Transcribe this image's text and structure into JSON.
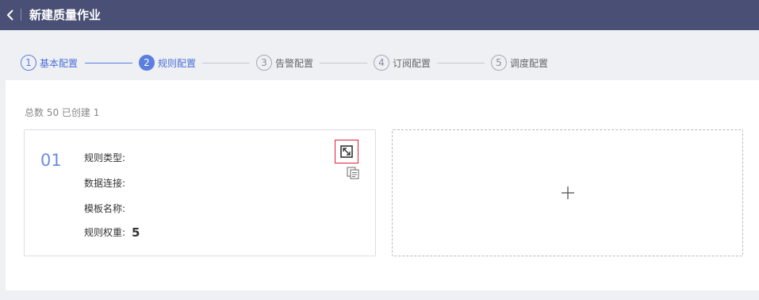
{
  "header": {
    "title": "新建质量作业",
    "back_icon": "chevron-left-icon"
  },
  "steps": [
    {
      "number": "1",
      "label": "基本配置",
      "state": "done"
    },
    {
      "number": "2",
      "label": "规则配置",
      "state": "active"
    },
    {
      "number": "3",
      "label": "告警配置",
      "state": "pending"
    },
    {
      "number": "4",
      "label": "订阅配置",
      "state": "pending"
    },
    {
      "number": "5",
      "label": "调度配置",
      "state": "pending"
    }
  ],
  "summary": "总数 50 已创建 1",
  "rule_card": {
    "index": "01",
    "rule_type_label": "规则类型:",
    "data_connection_label": "数据连接:",
    "template_name_label": "模板名称:",
    "weight_label": "规则权重:",
    "weight_value": "5",
    "expand_icon": "expand-icon",
    "copy_icon": "copy-icon"
  },
  "add_card": {
    "icon": "plus-icon"
  },
  "colors": {
    "topbar": "#4a5075",
    "accent": "#5b7fde",
    "highlight_border": "#e0203a",
    "background": "#eff0f4"
  }
}
